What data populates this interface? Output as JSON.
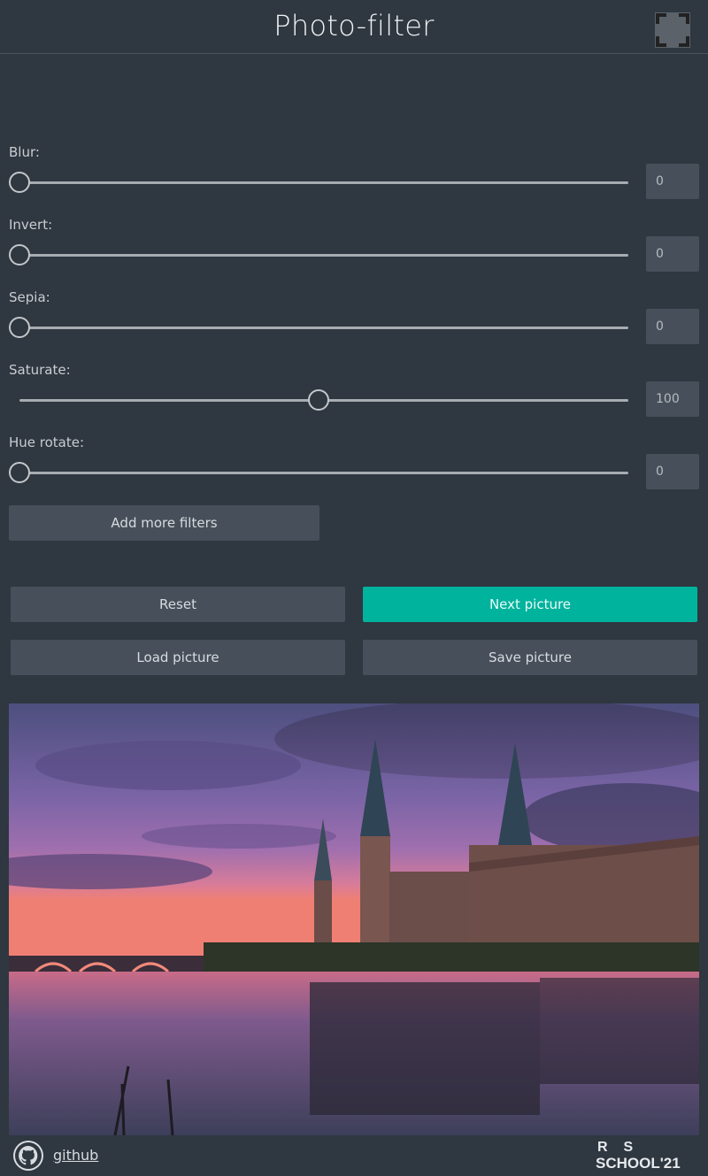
{
  "header": {
    "title": "Photo-filter",
    "fullscreen_icon": "fullscreen-icon"
  },
  "filters": [
    {
      "label": "Blur:",
      "value": "0",
      "fraction": 0
    },
    {
      "label": "Invert:",
      "value": "0",
      "fraction": 0
    },
    {
      "label": "Sepia:",
      "value": "0",
      "fraction": 0
    },
    {
      "label": "Saturate:",
      "value": "100",
      "fraction": 0.5
    },
    {
      "label": "Hue rotate:",
      "value": "0",
      "fraction": 0
    }
  ],
  "buttons": {
    "add_more": "Add more filters",
    "reset": "Reset",
    "next": "Next picture",
    "load": "Load picture",
    "save": "Save picture"
  },
  "colors": {
    "background": "#2f3740",
    "button": "#47505a",
    "accent": "#00b39d"
  },
  "footer": {
    "github_icon": "github-icon",
    "github_link": "github",
    "logo_line1": "RS",
    "logo_line2": "SCHOOL'21"
  }
}
